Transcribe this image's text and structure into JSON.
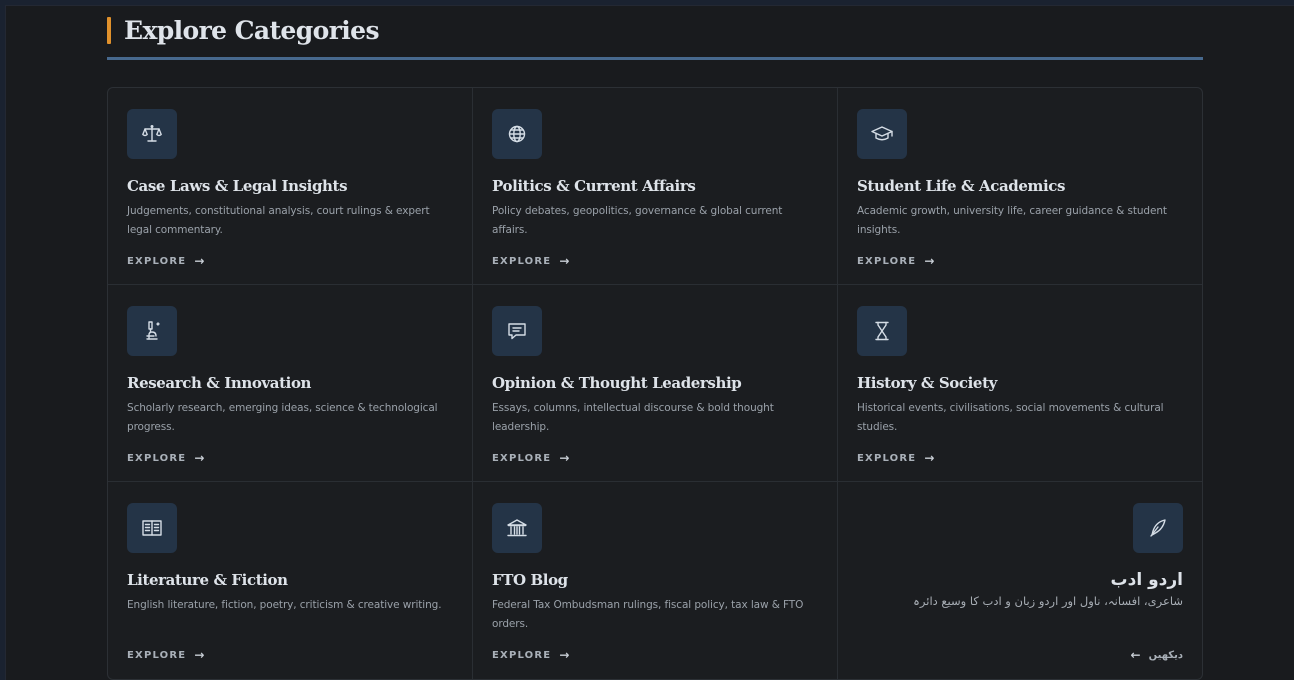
{
  "header": {
    "title": "Explore Categories",
    "accent_color": "#e0912c",
    "rule_color": "#47698e"
  },
  "categories": [
    {
      "title": "Case Laws & Legal Insights",
      "description": "Judgements, constitutional analysis, court rulings & expert legal commentary.",
      "link_label": "EXPLORE",
      "icon": "scales-icon"
    },
    {
      "title": "Politics & Current Affairs",
      "description": "Policy debates, geopolitics, governance & global current affairs.",
      "link_label": "EXPLORE",
      "icon": "globe-icon"
    },
    {
      "title": "Student Life & Academics",
      "description": "Academic growth, university life, career guidance & student insights.",
      "link_label": "EXPLORE",
      "icon": "graduation-cap-icon"
    },
    {
      "title": "Research & Innovation",
      "description": "Scholarly research, emerging ideas, science & technological progress.",
      "link_label": "EXPLORE",
      "icon": "microscope-icon"
    },
    {
      "title": "Opinion & Thought Leadership",
      "description": "Essays, columns, intellectual discourse & bold thought leadership.",
      "link_label": "EXPLORE",
      "icon": "speech-bubble-icon"
    },
    {
      "title": "History & Society",
      "description": "Historical events, civilisations, social movements & cultural studies.",
      "link_label": "EXPLORE",
      "icon": "hourglass-icon"
    },
    {
      "title": "Literature & Fiction",
      "description": "English literature, fiction, poetry, criticism & creative writing.",
      "link_label": "EXPLORE",
      "icon": "open-book-icon"
    },
    {
      "title": "FTO Blog",
      "description": "Federal Tax Ombudsman rulings, fiscal policy, tax law & FTO orders.",
      "link_label": "EXPLORE",
      "icon": "institution-icon"
    },
    {
      "title": "اردو ادب",
      "description": "شاعری، افسانہ، ناول اور اردو زبان و ادب کا وسیع دائرہ",
      "link_label": "دیکھیں",
      "icon": "quill-icon"
    }
  ]
}
